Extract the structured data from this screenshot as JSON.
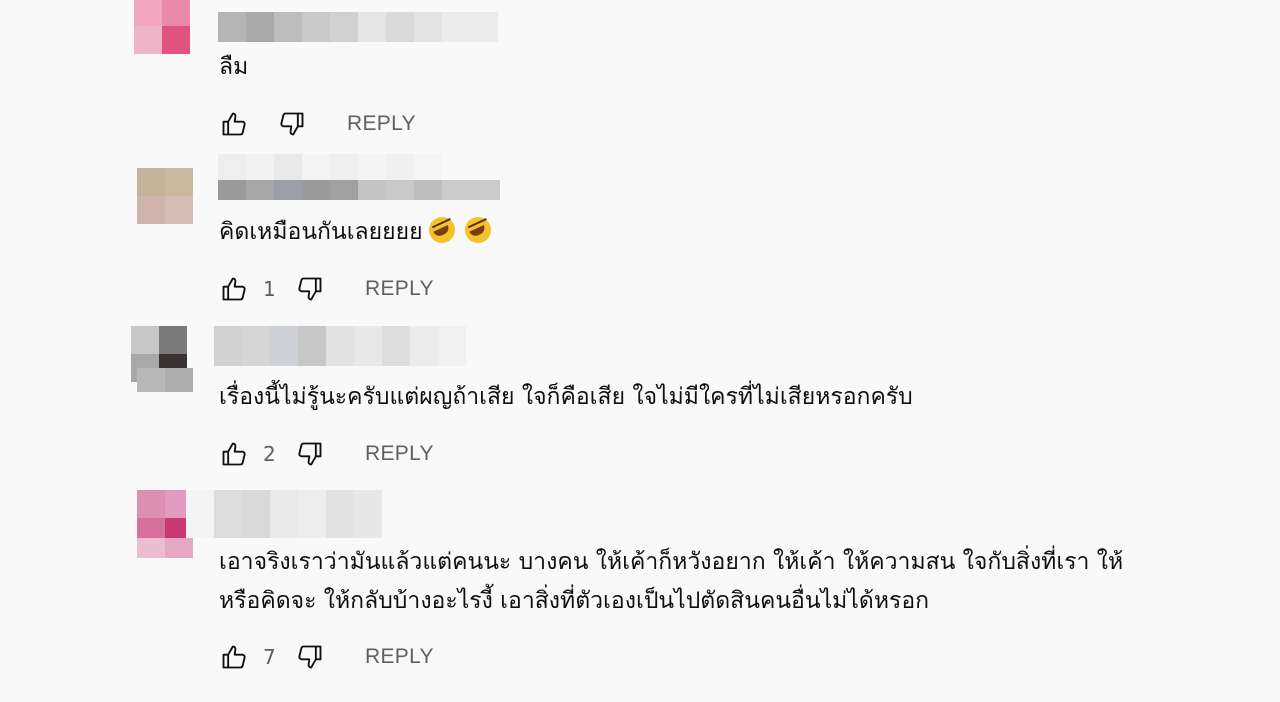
{
  "comments": [
    {
      "text": "ลืม",
      "like_count": "",
      "reply_label": "REPLY",
      "avatar_colors": [
        "#f2a6c0",
        "#ea8aaa",
        "#f0b4c8",
        "#e2527f"
      ],
      "name_blur": [
        "#b5b5b5",
        "#a9a9a9",
        "#bdbdbd",
        "#c9c9c9",
        "#d1d1d1",
        "#e5e5e5",
        "#d9d9d9",
        "#e3e3e3"
      ]
    },
    {
      "text": "คิดเหมือนกันเลยยยย",
      "like_count": "1",
      "reply_label": "REPLY",
      "avatar_colors": [
        "#c4b29a",
        "#c9b7a0",
        "#cfb4ab",
        "#d4bdb2"
      ],
      "name_blur": [
        "#9a9a9a",
        "#a7a7a7",
        "#9d9fa6",
        "#9a9a9a",
        "#a0a0a0",
        "#c4c4c4",
        "#c9c9c9",
        "#bdbdbd"
      ]
    },
    {
      "text": "เรื่องนี้ไม่รู้นะครับแต่ผญถ้าเสีย ใจก็คือเสีย ใจไม่มีใครที่ไม่เสียหรอกครับ",
      "like_count": "2",
      "reply_label": "REPLY",
      "avatar_colors": [
        "#c8c8c8",
        "#7a7a7a",
        "#b4b4b4",
        "#a8a8a8"
      ],
      "name_blur": [
        "#d2d2d2",
        "#d6d6d6",
        "#cdd0d4",
        "#c7c7c7",
        "#e2e2e2",
        "#e8e8e8",
        "#dedede",
        "#ececec"
      ]
    },
    {
      "text_line1": "เอาจริงเราว่ามันแล้วแต่คนนะ บางคน ให้เค้าก็หวังอยาก ให้เค้า ให้ความสน ใจกับสิ่งที่เรา ให้",
      "text_line2": "หรือคิดจะ ให้กลับบ้างอะไรงี้ เอาสิ่งที่ตัวเองเป็นไปตัดสินคนอื่นไม่ได้หรอก",
      "like_count": "7",
      "reply_label": "REPLY",
      "avatar_colors": [
        "#dc8fb2",
        "#d86f9c",
        "#eabdd0",
        "#e3a9c3"
      ],
      "name_blur": [
        "#e6e6e6",
        "#d9d9d9",
        "#dedede",
        "#e9e9e9",
        "#ededed",
        "#e2e2e2",
        "#e7e7e7",
        "#dddddd"
      ]
    }
  ]
}
